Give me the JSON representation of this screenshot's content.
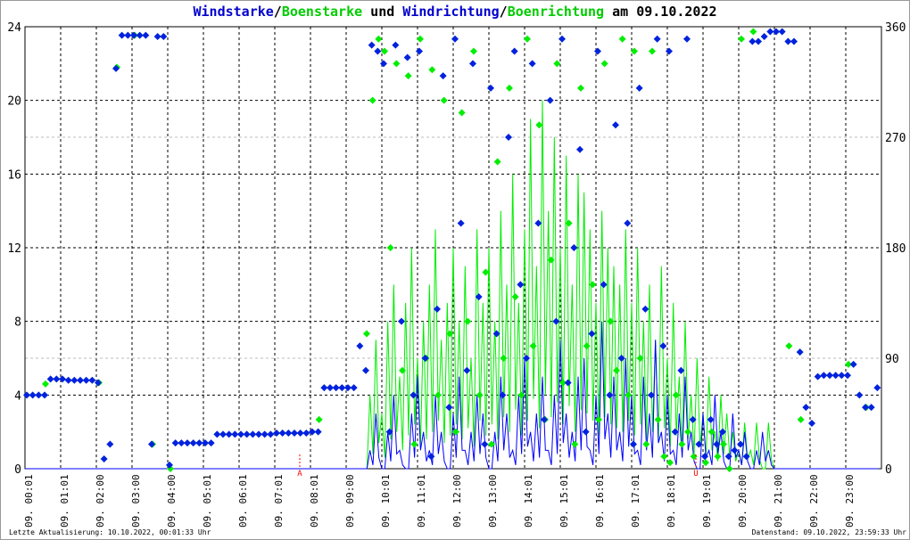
{
  "title": {
    "part1": "Windstarke",
    "sep1": "/",
    "part2": "Boenstarke",
    "und": " und ",
    "part3": "Windrichtung",
    "sep2": "/",
    "part4": "Boenrichtung",
    "date": " am 09.10.2022"
  },
  "footer": {
    "left": "Letzte Aktualisierung: 10.10.2022, 00:01:33 Uhr",
    "right": "Datenstand: 09.10.2022, 23:59:33 Uhr"
  },
  "colors": {
    "speed": "#0000ff",
    "gust": "#00ee00",
    "direction": "#0022dd",
    "gust_direction": "#00ee00",
    "marker": "#ff0000"
  },
  "chart_data": {
    "type": "line",
    "title": "Windstarke/Boenstarke und Windrichtung/Boenrichtung am 09.10.2022",
    "x_unit": "hours",
    "x_range": [
      0,
      24
    ],
    "sample_interval_minutes": 10,
    "x_tick_labels": [
      "09. 00:01",
      "09. 01:01",
      "09. 02:00",
      "09. 03:00",
      "09. 04:00",
      "09. 05:01",
      "09. 06:01",
      "09. 07:01",
      "09. 08:01",
      "09. 09:00",
      "09. 10:01",
      "09. 11:01",
      "09. 12:00",
      "09. 13:00",
      "09. 14:01",
      "09. 15:01",
      "09. 16:01",
      "09. 17:01",
      "09. 18:01",
      "09. 19:01",
      "09. 20:00",
      "09. 21:00",
      "09. 22:00",
      "09. 23:00"
    ],
    "y_left": {
      "range": [
        0,
        24
      ],
      "ticks": [
        "0",
        "4",
        "8",
        "12",
        "16",
        "20",
        "24"
      ]
    },
    "y_right": {
      "range": [
        0,
        360
      ],
      "ticks": [
        "0",
        "90",
        "180",
        "270",
        "360"
      ]
    },
    "grid": true,
    "annotations": [
      {
        "label": "A",
        "hour": 7.7
      },
      {
        "label": "U",
        "hour": 18.8
      }
    ],
    "series": [
      {
        "name": "Windstarke",
        "axis": "left",
        "style": "line",
        "values": [
          0,
          0,
          0,
          0,
          0,
          0,
          0,
          0,
          0,
          0,
          0,
          0,
          0,
          0,
          0,
          0,
          0,
          0,
          0,
          0,
          0,
          0,
          0,
          0,
          0,
          0,
          0,
          0,
          0,
          0,
          0,
          0,
          0,
          0,
          0,
          0,
          0,
          0,
          0,
          0,
          0,
          0,
          0,
          0,
          0,
          0,
          0,
          0,
          0,
          0,
          0,
          0,
          0,
          0,
          0,
          0,
          0,
          0,
          1,
          3,
          0,
          2,
          4,
          1,
          0,
          3,
          5,
          2,
          1,
          4,
          2,
          0,
          3,
          5,
          1,
          2,
          4,
          3,
          0,
          2,
          5,
          3,
          1,
          4,
          6,
          2,
          3,
          5,
          1,
          4,
          7,
          3,
          2,
          5,
          6,
          1,
          4,
          8,
          3,
          5,
          2,
          6,
          4,
          1,
          5,
          3,
          7,
          2,
          4,
          1,
          3,
          5,
          2,
          0,
          3,
          1,
          4,
          2,
          0,
          3,
          1,
          2,
          0,
          1,
          2,
          1,
          0,
          0,
          0,
          0,
          0,
          0,
          0,
          0,
          0,
          0,
          0,
          0,
          0,
          0,
          0,
          0,
          0,
          0
        ]
      },
      {
        "name": "Boenstarke",
        "axis": "left",
        "style": "line",
        "values": [
          0,
          0,
          0,
          0,
          0,
          0,
          0,
          0,
          0,
          0,
          0,
          0,
          0,
          0,
          0,
          0,
          0,
          0,
          0,
          0,
          0,
          0,
          0,
          0,
          0,
          0,
          0,
          0,
          0,
          0,
          0,
          0,
          0,
          0,
          0,
          0,
          0,
          0,
          0,
          0,
          0,
          0,
          0,
          0,
          0,
          0,
          0,
          0,
          0,
          0,
          0,
          0,
          0,
          0,
          0,
          0,
          0,
          0,
          4,
          7,
          3,
          8,
          10,
          5,
          9,
          12,
          6,
          8,
          10,
          13,
          7,
          9,
          12,
          8,
          11,
          6,
          13,
          9,
          12,
          8,
          14,
          10,
          16,
          9,
          13,
          19,
          11,
          20,
          14,
          18,
          12,
          17,
          10,
          16,
          15,
          13,
          9,
          14,
          12,
          11,
          10,
          13,
          9,
          12,
          8,
          10,
          7,
          11,
          6,
          9,
          5,
          8,
          4,
          6,
          3,
          5,
          2,
          4,
          3,
          2,
          1,
          2.5,
          1,
          2.5,
          0,
          2.5,
          0,
          0,
          0,
          0,
          0,
          0,
          0,
          0,
          0,
          0,
          0,
          0,
          0,
          0,
          0,
          0,
          0,
          0
        ]
      },
      {
        "name": "Windrichtung",
        "axis": "right",
        "style": "diamond",
        "values": [
          60,
          60,
          60,
          60,
          73,
          73,
          73,
          72,
          72,
          72,
          72,
          72,
          70,
          8,
          20,
          326,
          353,
          353,
          353,
          353,
          353,
          20,
          352,
          352,
          3,
          21,
          21,
          21,
          21,
          21,
          21,
          21,
          28,
          28,
          28,
          28,
          28,
          28,
          28,
          28,
          28,
          28,
          29,
          29,
          29,
          29,
          29,
          29,
          30,
          30,
          66,
          66,
          66,
          66,
          66,
          66,
          100,
          80,
          345,
          340,
          330,
          30,
          345,
          120,
          335,
          60,
          340,
          90,
          10,
          130,
          320,
          50,
          350,
          200,
          80,
          330,
          140,
          20,
          310,
          110,
          60,
          270,
          340,
          150,
          90,
          330,
          200,
          40,
          300,
          120,
          350,
          70,
          180,
          260,
          30,
          110,
          340,
          150,
          60,
          280,
          90,
          200,
          20,
          310,
          130,
          60,
          350,
          100,
          340,
          30,
          80,
          350,
          40,
          20,
          10,
          40,
          20,
          30,
          10,
          15,
          20,
          10,
          348,
          348,
          352,
          356,
          356,
          356,
          348,
          348,
          95,
          50,
          37,
          75,
          76,
          76,
          76,
          76,
          76,
          85,
          60,
          50,
          50,
          66
        ]
      },
      {
        "name": "Boenrichtung",
        "axis": "right",
        "style": "diamond",
        "values": [
          null,
          null,
          null,
          69,
          null,
          null,
          null,
          null,
          null,
          null,
          null,
          null,
          70,
          null,
          null,
          327,
          null,
          null,
          353,
          null,
          null,
          20,
          null,
          null,
          0,
          null,
          null,
          null,
          null,
          null,
          null,
          null,
          null,
          null,
          null,
          null,
          null,
          null,
          null,
          null,
          null,
          null,
          null,
          null,
          null,
          null,
          null,
          null,
          null,
          40,
          null,
          null,
          null,
          null,
          null,
          null,
          null,
          110,
          300,
          350,
          340,
          180,
          330,
          80,
          320,
          20,
          350,
          90,
          325,
          60,
          300,
          110,
          30,
          290,
          120,
          340,
          60,
          160,
          20,
          250,
          90,
          310,
          140,
          60,
          350,
          100,
          280,
          40,
          170,
          330,
          70,
          200,
          20,
          310,
          100,
          150,
          40,
          330,
          120,
          80,
          350,
          60,
          340,
          90,
          20,
          340,
          40,
          10,
          5,
          60,
          20,
          30,
          10,
          null,
          5,
          30,
          10,
          20,
          0,
          null,
          350,
          null,
          356,
          null,
          null,
          null,
          null,
          null,
          100,
          null,
          40,
          null,
          null,
          null,
          null,
          null,
          null,
          null,
          85,
          null,
          null,
          50,
          null,
          null
        ]
      }
    ]
  }
}
